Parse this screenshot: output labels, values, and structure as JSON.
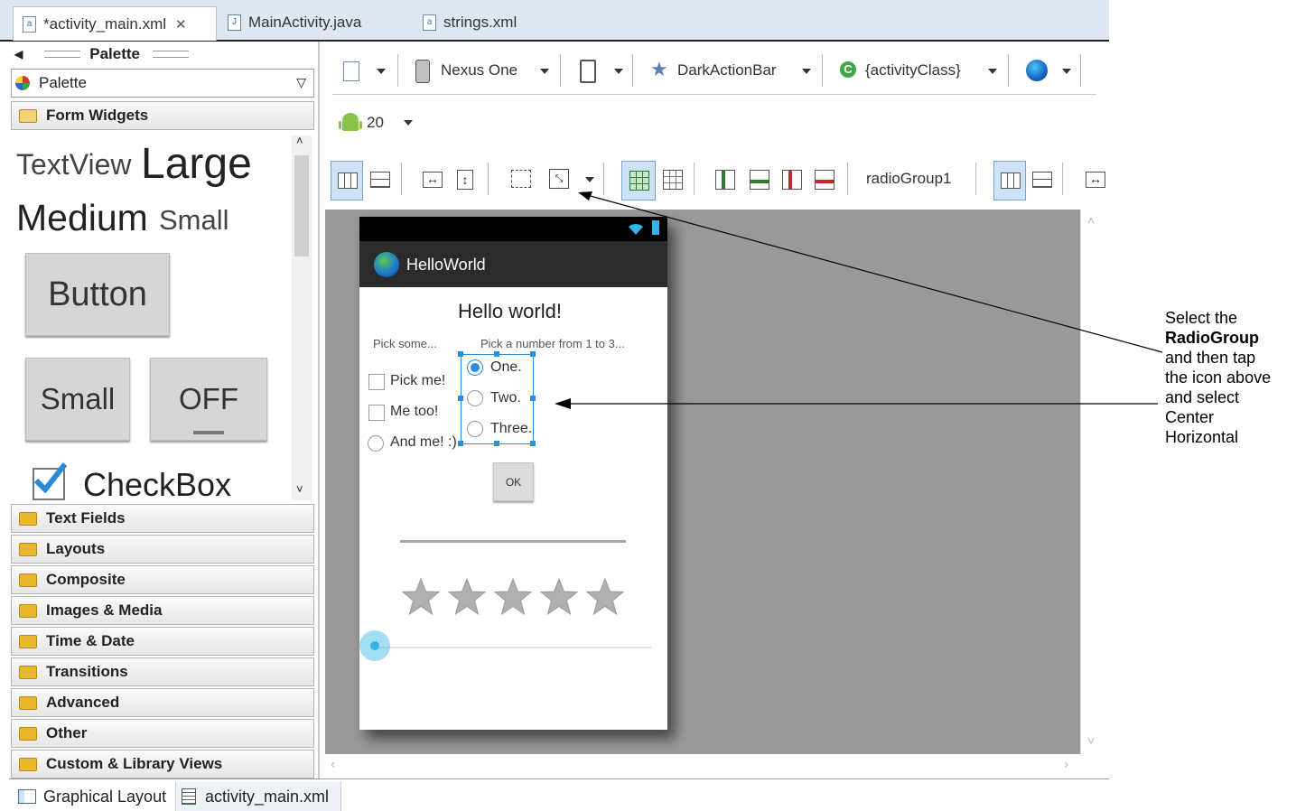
{
  "editor_tabs": [
    {
      "label": "*activity_main.xml",
      "active": true
    },
    {
      "label": "MainActivity.java",
      "active": false
    },
    {
      "label": "strings.xml",
      "active": false
    }
  ],
  "palette": {
    "header": "Palette",
    "selector_value": "Palette",
    "open_category": "Form Widgets",
    "widgets": {
      "textview": "TextView",
      "large": "Large",
      "medium": "Medium",
      "small_text": "Small",
      "button": "Button",
      "small_button": "Small",
      "toggle": "OFF",
      "checkbox": "CheckBox"
    },
    "categories": [
      "Text Fields",
      "Layouts",
      "Composite",
      "Images & Media",
      "Time & Date",
      "Transitions",
      "Advanced",
      "Other",
      "Custom & Library Views"
    ]
  },
  "toolbar": {
    "device": "Nexus One",
    "theme": "DarkActionBar",
    "activity": "{activityClass}",
    "api_level": "20",
    "selected_widget": "radioGroup1"
  },
  "preview": {
    "app_title": "HelloWorld",
    "hello": "Hello world!",
    "pick_some": "Pick some...",
    "pick_number": "Pick a number from 1 to 3...",
    "checkboxes": [
      "Pick me!",
      "Me too!"
    ],
    "radio_left": "And me! :)",
    "radio_options": [
      "One.",
      "Two.",
      "Three."
    ],
    "ok_button": "OK",
    "rating_stars": 5,
    "seek_progress": 0.0
  },
  "bottom_tabs": [
    "Graphical Layout",
    "activity_main.xml"
  ],
  "annotation": {
    "line1": "Select the",
    "bold": "RadioGroup",
    "rest": [
      "and then tap",
      "the icon above",
      "and select",
      "Center",
      "Horizontal"
    ]
  },
  "colors": {
    "accent_blue": "#2a8dde",
    "canvas_gray": "#999999",
    "action_bar": "#2b2b2b"
  }
}
